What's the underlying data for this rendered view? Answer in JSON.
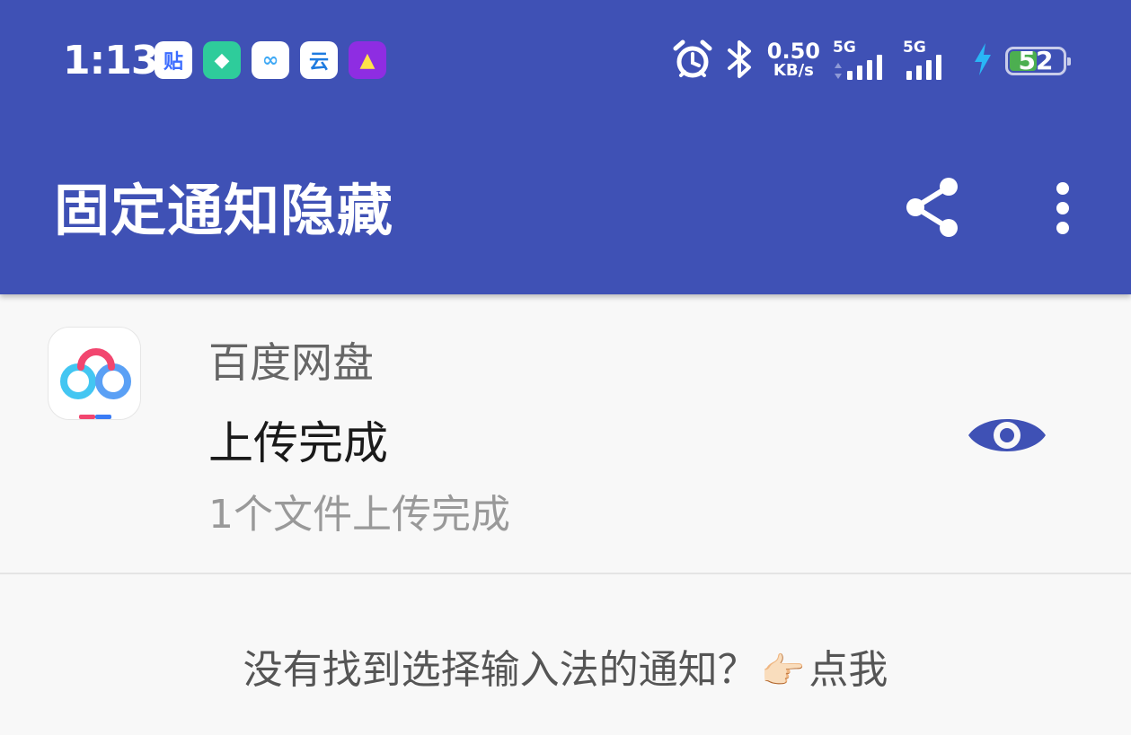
{
  "status_bar": {
    "time": "1:13",
    "notification_icons": [
      {
        "name": "tieba-icon",
        "glyph": "贴",
        "bg": "#ffffff",
        "fg": "#3b6cff"
      },
      {
        "name": "shield-app-icon",
        "glyph": "◆",
        "bg": "#2ecc9b",
        "fg": "#ffffff"
      },
      {
        "name": "baidu-netdisk-small-icon",
        "glyph": "∞",
        "bg": "#ffffff",
        "fg": "#3fa9f5"
      },
      {
        "name": "cloud-ai-icon",
        "glyph": "云",
        "bg": "#ffffff",
        "fg": "#1e7be0"
      },
      {
        "name": "car-app-icon",
        "glyph": "▲",
        "bg": "#8e2de2",
        "fg": "#ffe24a"
      }
    ],
    "net_speed_value": "0.50",
    "net_speed_unit": "KB/s",
    "signal1_label": "5G",
    "signal2_label": "5G",
    "battery_level": "52"
  },
  "header": {
    "title": "固定通知隐藏",
    "background": "#3f51b5"
  },
  "notification": {
    "app_name": "百度网盘",
    "title": "上传完成",
    "text": "1个文件上传完成",
    "eye_color": "#3f51b5"
  },
  "hint": {
    "text": "没有找到选择输入法的通知？",
    "finger": "👉🏻",
    "link": "点我"
  }
}
